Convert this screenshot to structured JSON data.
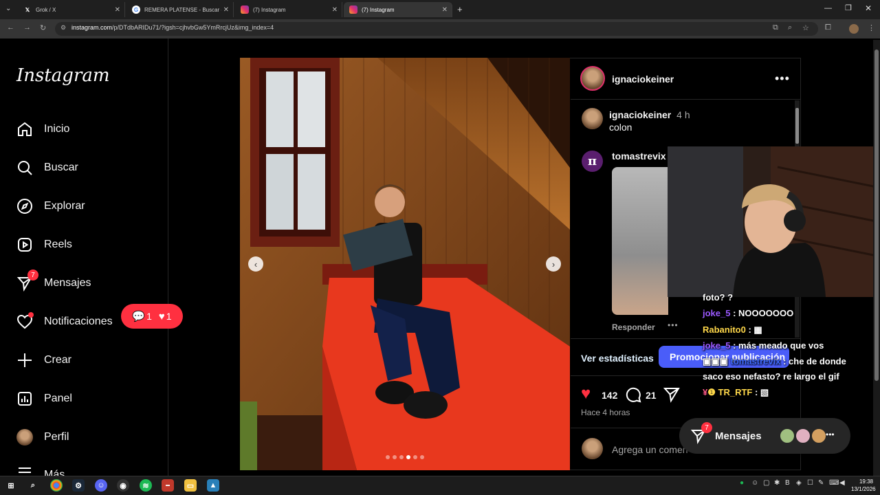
{
  "tabs": [
    {
      "title": "Grok / X",
      "icon": "x-logo-icon"
    },
    {
      "title": "REMERA PLATENSE - Buscar co",
      "icon": "google-icon"
    },
    {
      "title": "(7) Instagram",
      "icon": "instagram-icon"
    },
    {
      "title": "(7) Instagram",
      "icon": "instagram-icon"
    }
  ],
  "address": {
    "host": "instagram.com",
    "path": "/p/DTdbARIDu71/?igsh=cjhvbGw5YmRrcjUz&img_index=4"
  },
  "sidebar": {
    "logo": "Instagram",
    "items": [
      {
        "label": "Inicio",
        "icon": "home-icon"
      },
      {
        "label": "Buscar",
        "icon": "search-icon"
      },
      {
        "label": "Explorar",
        "icon": "compass-icon"
      },
      {
        "label": "Reels",
        "icon": "reels-icon"
      },
      {
        "label": "Mensajes",
        "icon": "messenger-icon",
        "badge": "7"
      },
      {
        "label": "Notificaciones",
        "icon": "heart-icon"
      },
      {
        "label": "Crear",
        "icon": "plus-icon"
      },
      {
        "label": "Panel",
        "icon": "chart-icon"
      },
      {
        "label": "Perfil",
        "icon": "avatar-icon"
      },
      {
        "label": "Más",
        "icon": "menu-icon"
      }
    ],
    "notification_pill": {
      "comments": "1",
      "likes": "1"
    }
  },
  "post": {
    "author": "ignaciokeiner",
    "caption_user": "ignaciokeiner",
    "caption_time": "4 h",
    "caption_text": "colon",
    "comment_user": "tomastrevix",
    "reply_label": "Responder",
    "stats_link": "Ver estadísticas",
    "promote_button": "Promocionar publicación",
    "likes": "142",
    "comments": "21",
    "time_ago": "Hace 4 horas",
    "comment_placeholder": "Agrega un comentario...",
    "comment_visible": "Agrega un comen",
    "carousel_count": 6,
    "carousel_active": 3
  },
  "chat": [
    {
      "user": "",
      "text": "foto? ?"
    },
    {
      "user": "joke_5",
      "text": "NOOOOOOO"
    },
    {
      "user": "Rabanito0",
      "text": ""
    },
    {
      "user": "joke_5",
      "text": "más meado que vos"
    },
    {
      "user": "tomastrevix",
      "text": "che de donde"
    },
    {
      "user": "",
      "text": "saco eso nefasto? re largo el gif"
    },
    {
      "user": "TR_RTF",
      "text": ""
    }
  ],
  "messages_pill": {
    "label": "Mensajes",
    "badge": "7"
  },
  "clock": {
    "time": "19:38",
    "date": "13/1/2026"
  },
  "colors": {
    "accent": "#ff3040",
    "primary_button": "#4a5df9",
    "link": "#e0f1ff"
  }
}
